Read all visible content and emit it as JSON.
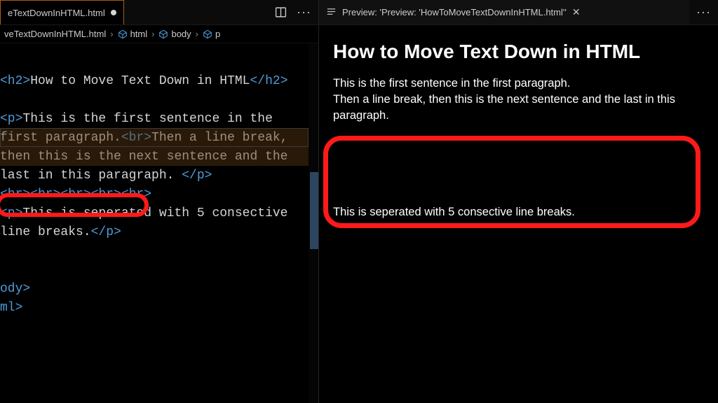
{
  "editor": {
    "tab": {
      "filename": "eTextDownInHTML.html"
    },
    "breadcrumbs": {
      "b0": "veTextDownInHTML.html",
      "b1": "html",
      "b2": "body",
      "b3": "p"
    },
    "code": {
      "h2_open": "<h2>",
      "h2_text": "How to Move Text Down in HTML",
      "h2_close": "</h2>",
      "p_open": "<p>",
      "p1a": "This is the first sentence in the first paragraph.",
      "br": "<br>",
      "p1b": "Then a line break, then this is the next sentence and the last in this paragraph. ",
      "p_close": "</p>",
      "brx5": "<br><br><br><br><br>",
      "p2": "This is seperated with 5 consective line breaks.",
      "body_close": "ody>",
      "html_close": "ml>"
    }
  },
  "preview": {
    "tab": {
      "label": "Preview: 'Preview: 'HowToMoveTextDownInHTML.html''"
    },
    "h2": "How to Move Text Down in HTML",
    "p1a": "This is the first sentence in the first paragraph.",
    "p1b": "Then a line break, then this is the next sentence and the last in this paragraph.",
    "p2": "This is seperated with 5 consective line breaks."
  }
}
